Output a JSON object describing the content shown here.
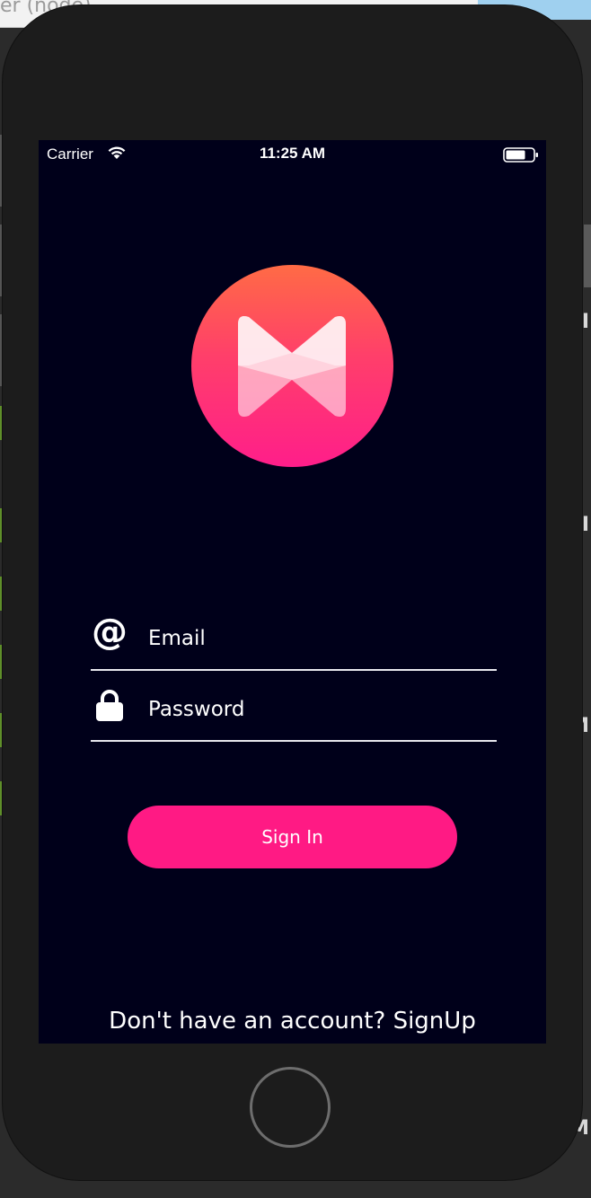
{
  "background": {
    "window_title": "er (node)",
    "right_letters": [
      "I",
      "I",
      "M",
      "M"
    ]
  },
  "status_bar": {
    "carrier": "Carrier",
    "time": "11:25 AM",
    "wifi_icon": "wifi-icon",
    "battery_icon": "battery-icon"
  },
  "logo": {
    "name": "musixmatch-logo",
    "gradient_top": "#ff6b45",
    "gradient_bottom": "#ff1e8a"
  },
  "form": {
    "email": {
      "icon": "at-sign-icon",
      "placeholder": "Email",
      "value": ""
    },
    "password": {
      "icon": "lock-icon",
      "placeholder": "Password",
      "value": ""
    }
  },
  "signin_button": {
    "label": "Sign In",
    "color": "#ff1a84"
  },
  "signup": {
    "prefix": "Don't have an account? ",
    "link": "SignUp"
  },
  "colors": {
    "screen_background": "#00001a",
    "accent": "#ff1a84",
    "text": "#ffffff"
  }
}
